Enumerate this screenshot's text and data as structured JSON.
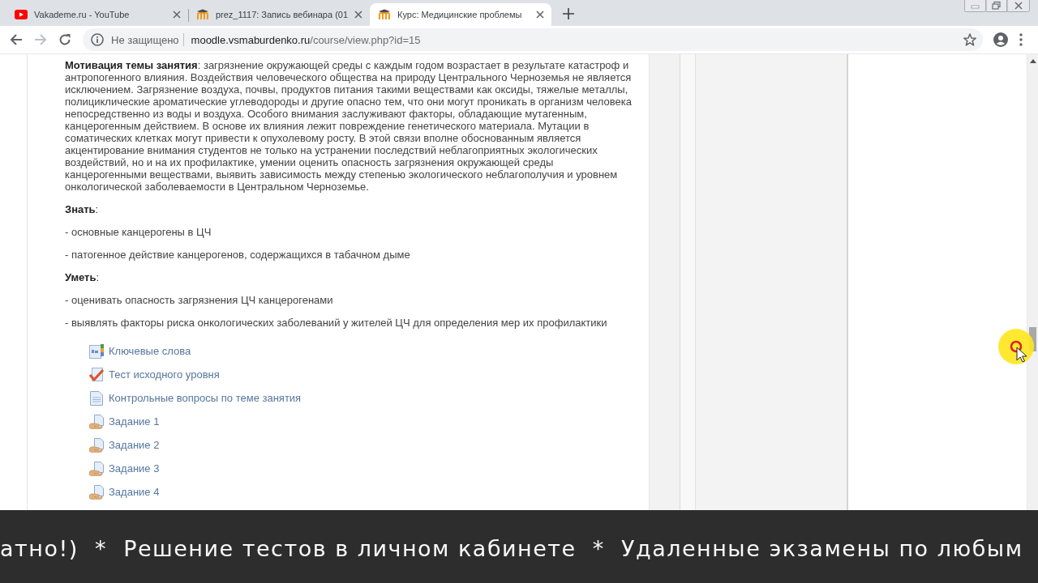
{
  "browser": {
    "tabs": [
      {
        "title": "Vakademe.ru - YouTube",
        "kind": "youtube",
        "selected": false
      },
      {
        "title": "prez_1117: Запись вебинара (01",
        "kind": "moodle",
        "selected": false
      },
      {
        "title": "Курс: Медицинские проблемы",
        "kind": "moodle",
        "selected": true
      }
    ],
    "navigation": {
      "back_disabled": false,
      "forward_disabled": true
    },
    "address_bar": {
      "security_label": "Не защищено",
      "domain": "moodle.vsmaburdenko.ru",
      "path": "/course/view.php?id=15"
    }
  },
  "course": {
    "motivation": "**Мотивация темы занятия**: загрязнение окружающей среды с каждым годом возрастает в результате катастроф и антропогенного влияния. Воздействия человеческого общества на природу Центрального Черноземья не является исключением. Загрязнение воздуха, почвы, продуктов питания такими веществами как оксиды, тяжелые металлы, полициклические ароматические углеводороды и другие опасно тем, что они могут проникать в организм человека непосредственно из воды и воздуха. Особого внимания заслуживают факторы, обладающие мутагенным, канцерогенным действием. В основе их влияния лежит повреждение генетического материала. Мутации в соматических клетках могут привести к опухолевому росту. В этой связи вполне обоснованным является акцентирование внимания студентов не только на устранении последствий неблагоприятных экологических воздействий, но и на их профилактике, умении оценить опасность загрязнения окружающей среды канцерогенными веществами, выявить зависимость между степенью экологического неблагополучия и уровнем онкологической заболеваемости в Центральном Черноземье.",
    "outcomes": [
      {
        "kind": "heading",
        "text": "**Знать**:"
      },
      {
        "kind": "item",
        "text": "- основные канцерогены в ЦЧ"
      },
      {
        "kind": "item",
        "text": "- патогенное действие канцерогенов, содержащихся в табачном дыме"
      },
      {
        "kind": "heading",
        "text": "**Уметь**:"
      },
      {
        "kind": "item",
        "text": "- оценивать опасность загрязнения ЦЧ канцерогенами"
      },
      {
        "kind": "item",
        "text": "- выявлять факторы риска онкологических заболеваний у жителей ЦЧ для определения мер их профилактики"
      }
    ],
    "activities": [
      {
        "title": "Ключевые слова",
        "kind": "glossary"
      },
      {
        "title": "Тест исходного уровня",
        "kind": "quiz"
      },
      {
        "title": "Контрольные вопросы по теме занятия",
        "kind": "page"
      },
      {
        "title": "Задание 1",
        "kind": "assignment"
      },
      {
        "title": "Задание 2",
        "kind": "assignment"
      },
      {
        "title": "Задание 3",
        "kind": "assignment"
      },
      {
        "title": "Задание 4",
        "kind": "assignment"
      }
    ]
  },
  "ticker": {
    "text": "атно!)  *  Решение тестов в личном кабинете  *  Удаленные экзамены по любым"
  }
}
